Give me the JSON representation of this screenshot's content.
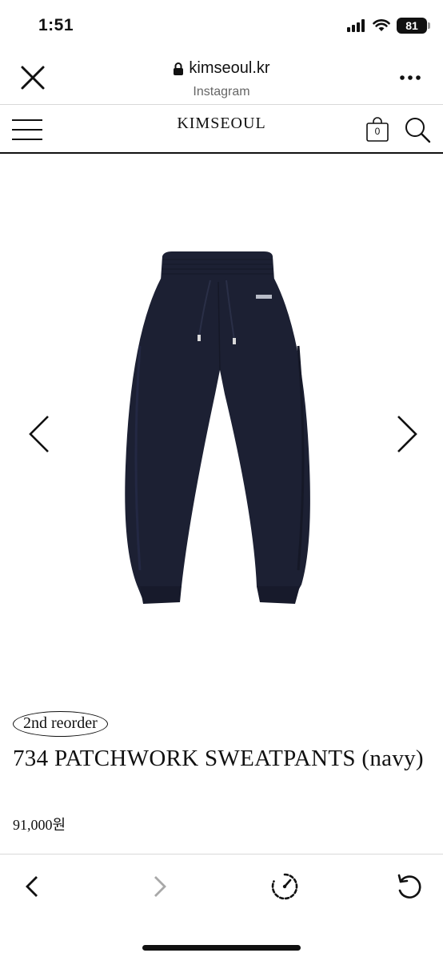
{
  "status_bar": {
    "time": "1:51",
    "battery": "81",
    "icons": [
      "signal-icon",
      "wifi-icon",
      "battery-icon"
    ]
  },
  "browser": {
    "domain": "kimseoul.kr",
    "subtitle": "Instagram",
    "icons": [
      "close-icon",
      "lock-icon",
      "more-icon"
    ]
  },
  "site": {
    "brand": "KIMSEOUL",
    "cart_count": "0",
    "icons": [
      "menu-icon",
      "bag-icon",
      "search-icon"
    ]
  },
  "gallery": {
    "icons": [
      "chevron-left-icon",
      "chevron-right-icon"
    ],
    "product_color": "#1c2033"
  },
  "product": {
    "badge": "2nd reorder",
    "title": "734 PATCHWORK SWEATPANTS (navy)",
    "price": "91,000원"
  },
  "toolbar": {
    "icons": [
      "back-icon",
      "forward-icon",
      "speed-icon",
      "reload-icon"
    ]
  }
}
